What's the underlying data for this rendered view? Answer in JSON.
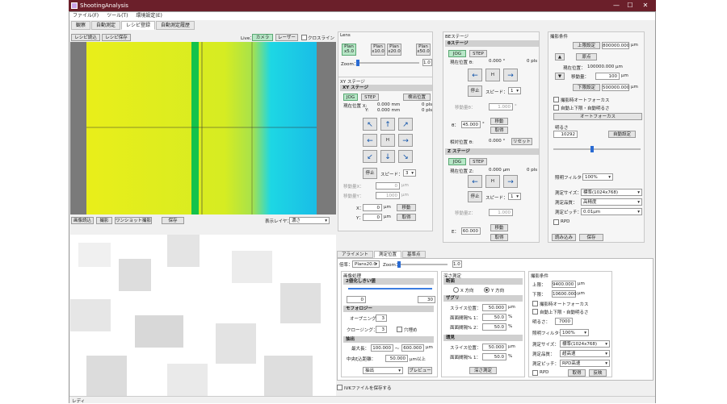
{
  "window": {
    "title": "ShootingAnalysis",
    "min": "—",
    "max": "☐",
    "close": "✕"
  },
  "menu": [
    "ファイル(F)",
    "ツール(T)",
    "環境設定(E)"
  ],
  "tabs": [
    {
      "label": "観察"
    },
    {
      "label": "自動測定"
    },
    {
      "label": "レシピ登録"
    },
    {
      "label": "自動測定履歴"
    }
  ],
  "recipe": {
    "read": "レシピ読込",
    "save": "レシピ保存"
  },
  "live": {
    "label": "Live：",
    "camera": "カメラ",
    "laser": "レーザー",
    "crossline": "クロスライン"
  },
  "image_toolbar": {
    "load": "画像読込",
    "shoot": "撮影",
    "oneshot": "ワンショット撮影",
    "save": "保存",
    "display_layer": "表示レイヤ：",
    "layer_value": "濃さ"
  },
  "lens": {
    "title": "Lens",
    "options": [
      "Plan\nx5.0",
      "Plan\nx10.0",
      "Plan\nx20.0",
      "Plan\nx50.0"
    ],
    "zoom_label": "Zoom：",
    "zoom_value": "1.0"
  },
  "xy": {
    "stage_title": "XY ステージ",
    "sub_title": "XY ステージ",
    "jog": "JOG",
    "step": "STEP",
    "detect": "検出位置",
    "cur_label": "現在位置 X:",
    "y_label": "Y:",
    "x_val": "0.000 mm",
    "y_val": "0.000 mm",
    "x_pls": "0 pls",
    "y_pls": "0 pls",
    "up": "↑",
    "down": "↓",
    "left": "←",
    "right": "→",
    "ul": "↖",
    "ur": "↗",
    "dl": "↙",
    "dr": "↘",
    "home": "H",
    "stop": "停止",
    "speed": "スピード：",
    "speed_val": "3",
    "move_x": "移動量X：",
    "move_y": "移動量Y：",
    "move_x_val": "0",
    "move_y_val": "1000",
    "unit_um": "μm",
    "x2": "X：",
    "y2": "Y：",
    "x2_val": "0",
    "y2_val": "0",
    "move": "移動",
    "get": "取得"
  },
  "be": {
    "title": "BEステージ",
    "theta_title": "θステージ",
    "jog": "JOG",
    "step": "STEP",
    "cur": "現在位置 θ:",
    "cur_val": "0.000 °",
    "cur_pls": "0 pls",
    "home": "H",
    "stop": "停止",
    "speed": "スピード：",
    "speed_val": "1",
    "move_amt": "移動量θ：",
    "move_amt_val": "1.000",
    "theta_lbl": "θ：",
    "theta_val": "45.000",
    "deg": "°",
    "move": "移動",
    "get": "取得",
    "reset": "リセット",
    "rel": "相対位置 θ:",
    "rel_val": "0.000 °",
    "z_title": "Z ステージ",
    "z_cur": "現在位置 Z:",
    "z_cur_val": "0.000 μm",
    "z_pls": "0 pls",
    "z_move_amt": "移動量Z：",
    "z_move_amt_val": "1.000",
    "e_lbl": "E：",
    "e_val": "60.000",
    "left": "←",
    "right": "→"
  },
  "cond": {
    "title": "撮影条件",
    "upper": "上限設定",
    "upper_val": "800000.000",
    "um": "μm",
    "up": "▲",
    "down": "▼",
    "origin": "原点",
    "pos": "現在位置：",
    "pos_val": "100000.000 μm",
    "move_amt": "移動量：",
    "move_amt_val": "100",
    "lower": "下限設定",
    "lower_val": "500000.000",
    "af": "撮影時オートフォーカス",
    "auto_range": "自動上下限・自動明るさ",
    "autofocus": "オートフォーカス",
    "brightness": "明るさ",
    "bright_val": "10292",
    "auto_set": "自動設定",
    "filter": "照明フィルター：",
    "filter_val": "100%",
    "size": "測定サイズ：",
    "size_val": "標準(1024x768)",
    "quality": "測定品質：",
    "quality_val": "高精度",
    "pitch": "測定ピッチ：",
    "pitch_val": "0.01μm",
    "rpd": "RPD",
    "load": "読み込み",
    "save": "保存"
  },
  "bottom_tabs": [
    {
      "label": "アライメント"
    },
    {
      "label": "測定位置"
    },
    {
      "label": "基準点"
    }
  ],
  "bottom": {
    "mag": "倍率：",
    "mag_val": "Plans20.0",
    "zoom": "Zoom：",
    "zoom_val": "1.0",
    "img_proc": "画像処理",
    "binary": "2値化しきい値",
    "bin_lo": "0",
    "bin_hi": "30",
    "morph": "モフォロジー",
    "open": "オープニング：",
    "open_val": "3",
    "close": "クロージング：",
    "close_val": "3",
    "hole": "穴埋め",
    "extract": "抽出",
    "max_len": "最大長：",
    "max_lo": "100.000",
    "tilde": "〜",
    "max_hi": "600.000",
    "um": "μm",
    "center_dist": "中央ξ込距離：",
    "center_val": "50.000",
    "um_over": "μm以上",
    "extract_sel": "抽出",
    "preview": "プレビュー",
    "depth": "深さ測定",
    "section": "断面",
    "x_dir": "X 方向",
    "y_dir": "Y 方向",
    "zaguri": "ザグリ",
    "slice": "スライス位置：",
    "slice_val": "50.000",
    "gaps1": "面面間隔% 1：",
    "gaps1_val": "50.0",
    "gaps2": "面面間隔% 2：",
    "gaps2_val": "50.0",
    "pct": "%",
    "rim": "環見",
    "rim_slice_val": "50.000",
    "rim_gaps_val": "50.0",
    "depth_measure": "深さ測定",
    "cond_title": "撮影条件",
    "upper": "上限：",
    "upper_val": "9400.000",
    "lower": "下限：",
    "lower_val": "10600.000",
    "af": "撮影時オートフォーカス",
    "auto_range": "自動上下限・自動明るさ",
    "bright": "明るさ：",
    "bright_val": "7000",
    "filter": "照明フィルター：",
    "filter_val": "100%",
    "size": "測定サイズ：",
    "size_val": "標準(1024x768)",
    "quality": "測定品質：",
    "quality_val": "超高速",
    "pitch": "測定ピッチ：",
    "pitch_val": "RPD高速",
    "rpd": "RPD",
    "get": "取得",
    "copy": "反映"
  },
  "save_ivk": "IVKファイルを保存する",
  "status": "レディ",
  "colors": {
    "title": "#6b1f2a",
    "sel": "#b7e7c7",
    "arrow": "#0a4fa8"
  }
}
